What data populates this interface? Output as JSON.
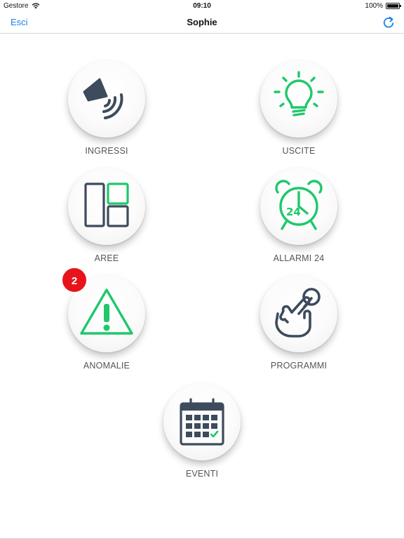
{
  "status_bar": {
    "carrier": "Gestore",
    "time": "09:10",
    "battery": "100%",
    "battery_level": 1.0
  },
  "nav": {
    "left_label": "Esci",
    "title": "Sophie",
    "refresh_icon": "refresh-icon"
  },
  "colors": {
    "accent_blue": "#1a82e8",
    "green": "#1ec86b",
    "slate": "#3d4b5c",
    "badge_red": "#e8141b"
  },
  "tiles": [
    {
      "label": "INGRESSI",
      "icon": "speaker-sound-icon"
    },
    {
      "label": "USCITE",
      "icon": "lightbulb-icon"
    },
    {
      "label": "AREE",
      "icon": "areas-grid-icon"
    },
    {
      "label": "ALLARMI 24",
      "icon": "alarm-clock-24-icon"
    },
    {
      "label": "ANOMALIE",
      "icon": "warning-triangle-icon",
      "badge": "2"
    },
    {
      "label": "PROGRAMMI",
      "icon": "hand-touch-icon"
    },
    {
      "label": "EVENTI",
      "icon": "calendar-icon"
    }
  ]
}
